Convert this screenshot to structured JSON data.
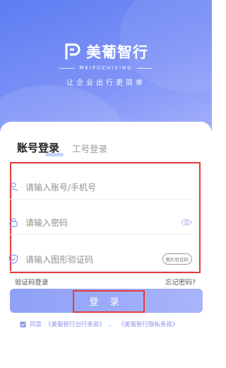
{
  "brand": {
    "name": "美葡智行",
    "pinyin": "MEIPUZHIXING",
    "slogan": "让企业出行更简单"
  },
  "tabs": {
    "active": "账号登录",
    "other": "工号登录"
  },
  "form": {
    "account_placeholder": "请输入账号/手机号",
    "password_placeholder": "请输入密码",
    "captcha_placeholder": "请输入图形验证码",
    "captcha_button": "图片验证码"
  },
  "links": {
    "code_login": "验证码登录",
    "forgot_password": "忘记密码?"
  },
  "login_button": "登 录",
  "agreement": {
    "prefix": "同意",
    "terms": "《美葡智行出行条款》",
    "separator": "、",
    "privacy": "《美葡智行隐私条款》"
  },
  "colors": {
    "primary": "#5d7df2",
    "button": "#8ea0f7",
    "highlight": "#e23b3b"
  }
}
